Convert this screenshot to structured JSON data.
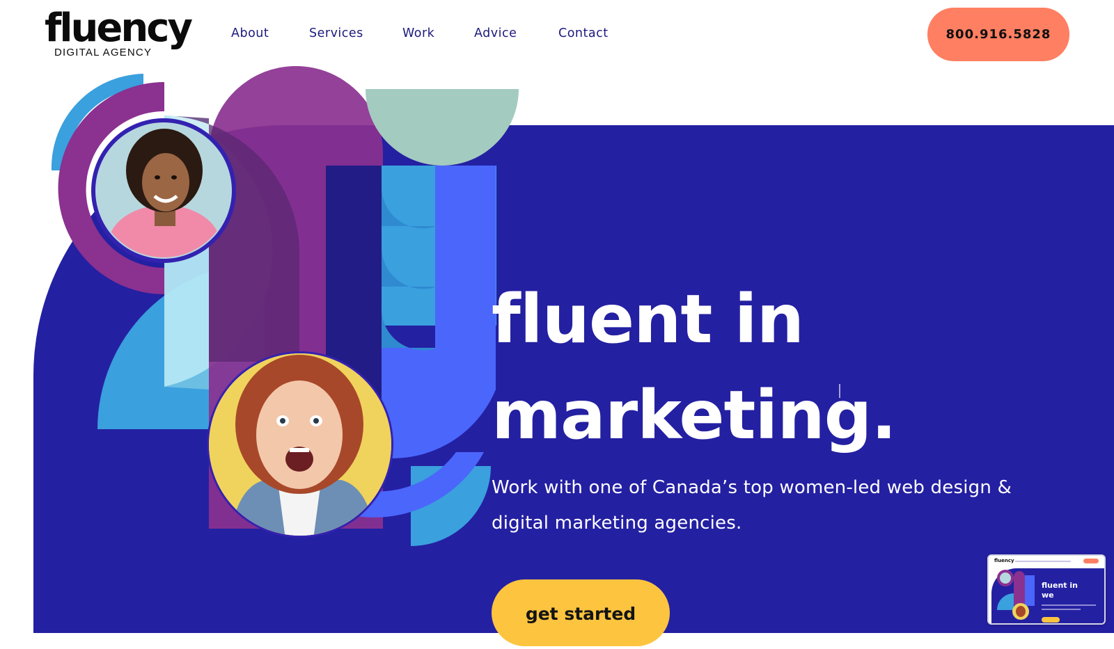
{
  "brand": {
    "name": "fluency",
    "tagline": "DIGITAL AGENCY"
  },
  "nav": {
    "items": [
      "About",
      "Services",
      "Work",
      "Advice",
      "Contact"
    ]
  },
  "header": {
    "phone": "800.916.5828"
  },
  "hero": {
    "headline_line1": "fluent in",
    "headline_line2": "marketing.",
    "subtext": "Work with one of Canada’s top women-led web design & digital marketing agencies.",
    "cta_label": "get started"
  },
  "preview_thumbnail": {
    "logo": "fluency",
    "headline_line1": "fluent in",
    "headline_line2": "we"
  },
  "colors": {
    "hero_background": "#2420a2",
    "nav_text": "#1c1a7c",
    "phone_button": "#ff7f62",
    "cta_button": "#fdc43f",
    "purple_shape": "#8b3190",
    "sky_blue_shape": "#3aa0de",
    "periwinkle_shape": "#4b66fb",
    "sage_shape": "#a4cbbf"
  }
}
